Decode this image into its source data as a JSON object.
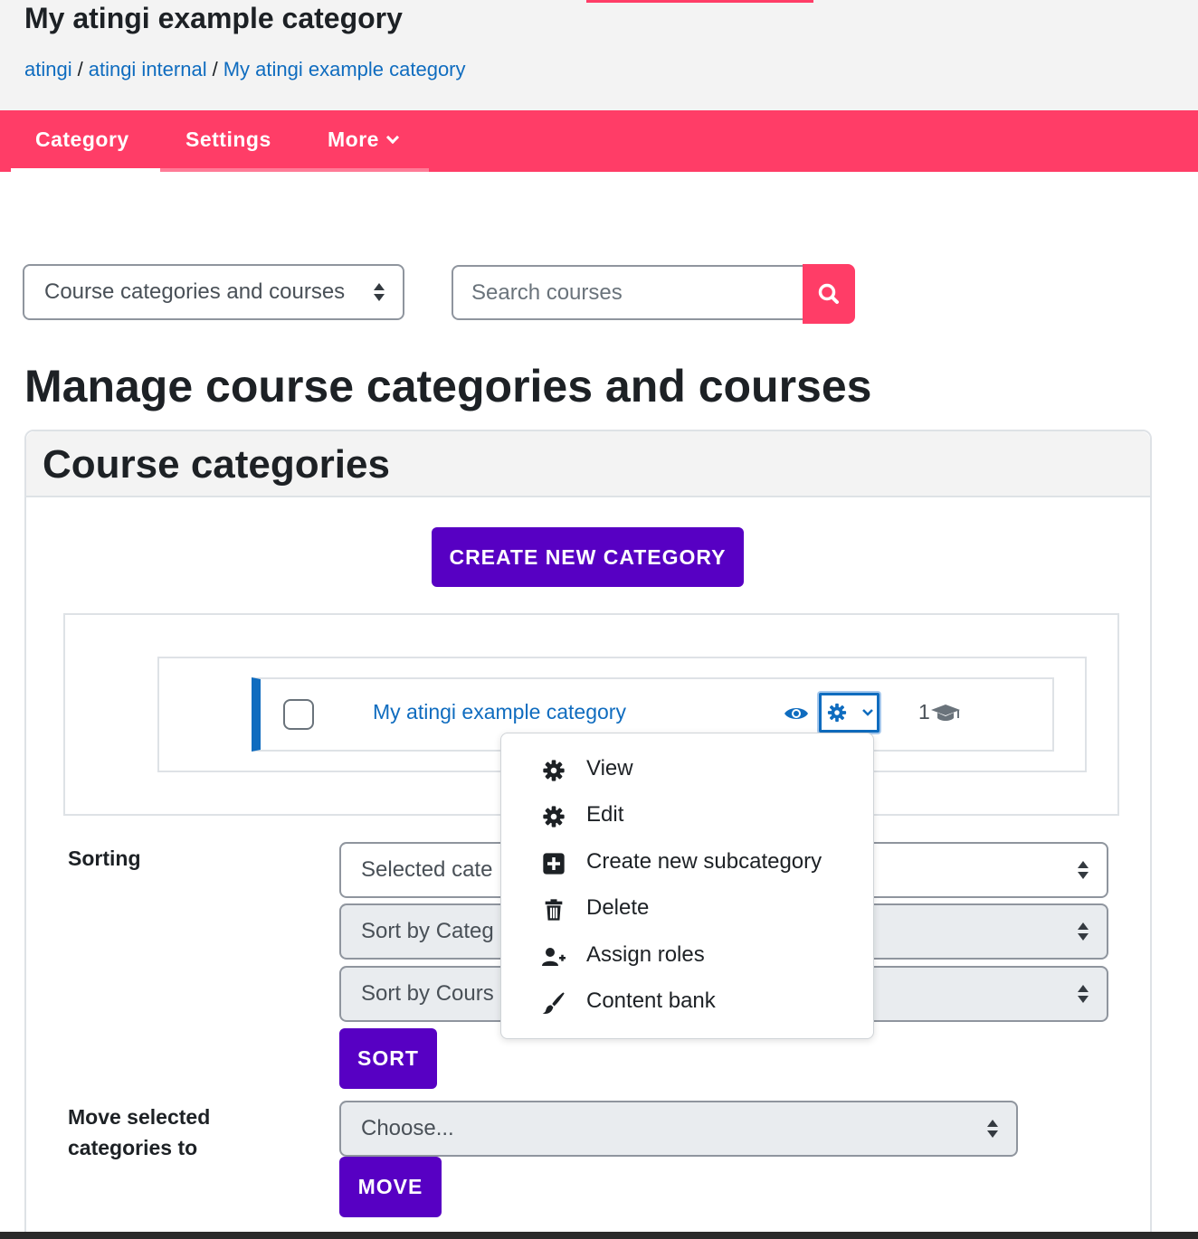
{
  "header": {
    "title": "My atingi example category",
    "breadcrumb": [
      {
        "label": "atingi"
      },
      {
        "label": "atingi internal"
      },
      {
        "label": "My atingi example category"
      }
    ]
  },
  "nav": {
    "tabs": [
      {
        "label": "Category",
        "active": true
      },
      {
        "label": "Settings",
        "active": false
      },
      {
        "label": "More",
        "active": false
      }
    ]
  },
  "view_select": {
    "value": "Course categories and courses"
  },
  "search": {
    "placeholder": "Search courses"
  },
  "main": {
    "title": "Manage course categories and courses"
  },
  "categories_card": {
    "title": "Course categories",
    "create_button": "CREATE NEW CATEGORY",
    "category_row": {
      "name": "My atingi example category",
      "course_count": "1"
    },
    "actions_menu": [
      {
        "label": "View",
        "icon": "gear-icon"
      },
      {
        "label": "Edit",
        "icon": "gear-icon"
      },
      {
        "label": "Create new subcategory",
        "icon": "plus-square-icon"
      },
      {
        "label": "Delete",
        "icon": "trash-icon"
      },
      {
        "label": "Assign roles",
        "icon": "user-plus-icon"
      },
      {
        "label": "Content bank",
        "icon": "paint-brush-icon"
      }
    ]
  },
  "sorting": {
    "label": "Sorting",
    "select1": "Selected cate",
    "select2": "Sort by Categ",
    "select3": "Sort by Cours",
    "button": "SORT"
  },
  "move": {
    "label_line1": "Move selected",
    "label_line2": "categories to",
    "select": "Choose...",
    "button": "MOVE"
  },
  "colors": {
    "brand_pink": "#ff3d67",
    "primary_purple": "#5700c3",
    "link_blue": "#0f6cbf"
  }
}
